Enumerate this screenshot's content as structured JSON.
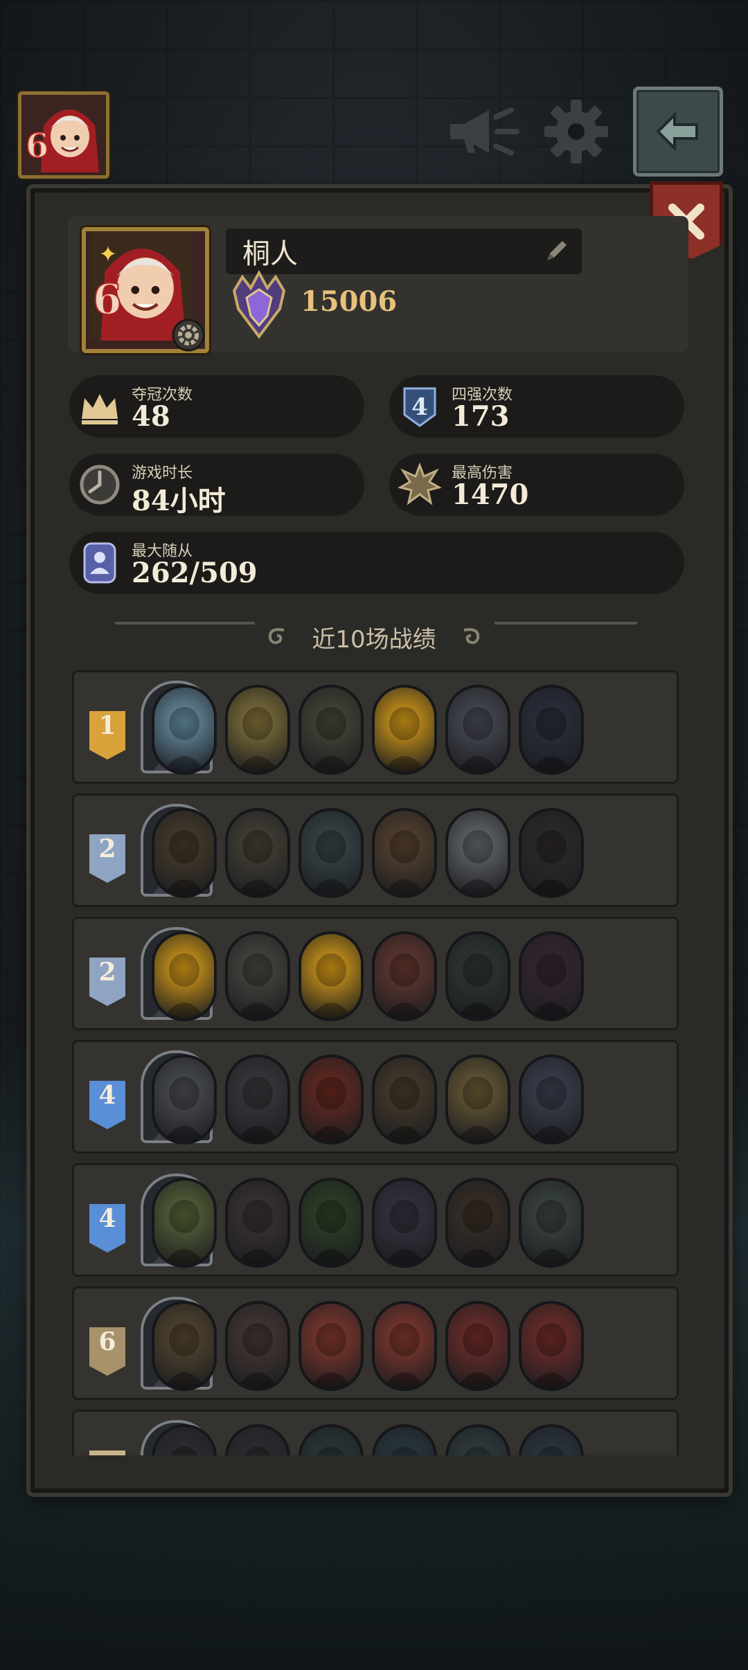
{
  "top_bar": {
    "avatar_level": "6",
    "icons": [
      "megaphone-icon",
      "gear-icon",
      "back-arrow-icon"
    ]
  },
  "profile": {
    "name": "桐人",
    "score": "15006",
    "level": "6"
  },
  "stats": {
    "champion": {
      "label": "夺冠次数",
      "value": "48"
    },
    "top4": {
      "label": "四强次数",
      "value": "173",
      "icon_text": "4"
    },
    "playtime": {
      "label": "游戏时长",
      "value": "84小时"
    },
    "max_damage": {
      "label": "最高伤害",
      "value": "1470"
    },
    "max_minions": {
      "label": "最大随从",
      "value": "262/509"
    }
  },
  "recent": {
    "title": "近10场战绩",
    "matches": [
      {
        "place": "1",
        "badge_color": "#d9a23a",
        "hero": "goat-hero",
        "units": [
          "#6f9ab0",
          "#8c7a3c",
          "#4a4a3a",
          "#e6a617",
          "#4d4f5a",
          "#2c3140"
        ]
      },
      {
        "place": "2",
        "badge_color": "#8ea4c2",
        "hero": "pirate-pig-hero",
        "units": [
          "#4b3e2b",
          "#4a4538",
          "#3a4a4c",
          "#5e4630",
          "#6b6f73",
          "#2f2b2a"
        ]
      },
      {
        "place": "2",
        "badge_color": "#8ea4c2",
        "hero": "fairy-hero",
        "units": [
          "#e6a617",
          "#4d4a42",
          "#e6a617",
          "#6b3a30",
          "#2f3a34",
          "#3a2634"
        ]
      },
      {
        "place": "4",
        "badge_color": "#5a8ed6",
        "hero": "shark-hero",
        "units": [
          "#4f5257",
          "#3a3c3f",
          "#6e2a1f",
          "#4b3e2b",
          "#706036",
          "#3f4454"
        ]
      },
      {
        "place": "4",
        "badge_color": "#5a8ed6",
        "hero": "shadow-hero",
        "units": [
          "#5d6a3a",
          "#3e3434",
          "#2f4426",
          "#3a3442",
          "#3c3027",
          "#3f4a44"
        ]
      },
      {
        "place": "6",
        "badge_color": "#a8926c",
        "hero": "goat-hero",
        "units": [
          "#5a4a30",
          "#4a3a34",
          "#8c3a2e",
          "#8c3a2e",
          "#7a2e2a",
          "#7a2e2a"
        ]
      },
      {
        "place": "",
        "badge_color": "#c9b48a",
        "hero": "hooded-hero",
        "units": [
          "#2e3033",
          "#2e3033",
          "#2b3b3a",
          "#2a3c44",
          "#334044",
          "#2d3a44"
        ]
      }
    ]
  }
}
